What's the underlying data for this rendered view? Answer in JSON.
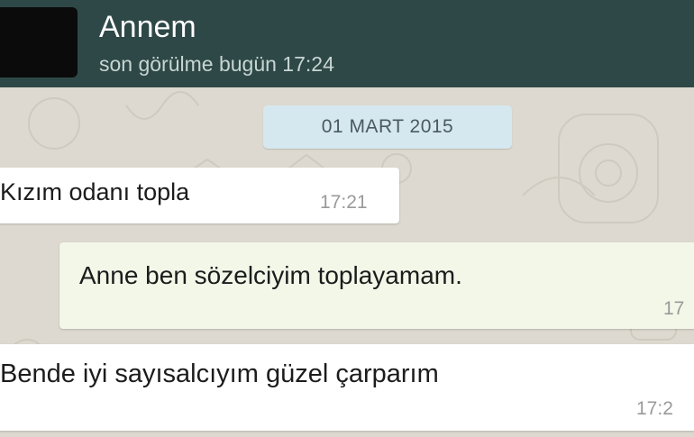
{
  "header": {
    "contact_name": "Annem",
    "last_seen": "son görülme bugün 17:24"
  },
  "chat": {
    "date_label": "01 MART 2015",
    "messages": [
      {
        "direction": "incoming",
        "text": "Kızım odanı topla",
        "time": "17:21"
      },
      {
        "direction": "outgoing",
        "text": "Anne ben sözelciyim toplayamam.",
        "time": "17"
      },
      {
        "direction": "incoming",
        "text": "Bende iyi sayısalcıyım güzel çarparım",
        "time": "17:2"
      }
    ]
  },
  "colors": {
    "header_bg": "#2e4847",
    "chat_bg": "#ddd9d0",
    "incoming_bubble": "#ffffff",
    "outgoing_bubble": "#f2f7e8",
    "date_chip": "#d6e8ef"
  }
}
